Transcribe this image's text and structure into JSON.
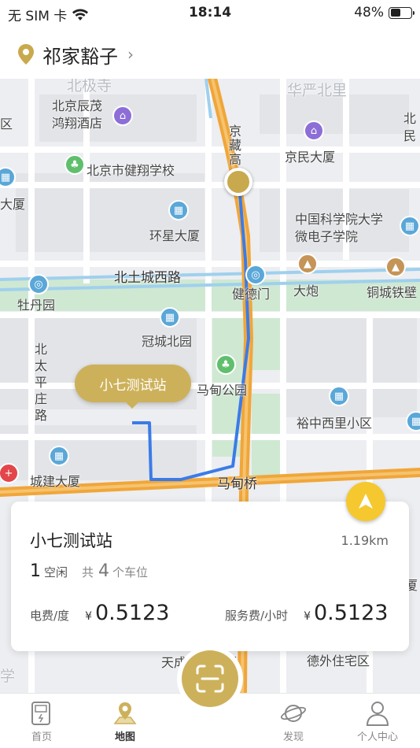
{
  "status_bar": {
    "carrier": "无 SIM 卡",
    "time": "18:14",
    "battery": "48%",
    "battery_level": 0.48
  },
  "location": {
    "name": "祁家豁子"
  },
  "map": {
    "labels": {
      "beiji_temple": "北极寺",
      "huayan_beili": "华严北里",
      "hotel": "北京辰茂\n鸿翔酒店",
      "jingzang": "京藏高",
      "jingmin": "京民大厦",
      "school": "北京市健翔学校",
      "dasha_left": "大厦",
      "huanxing": "环星大厦",
      "cas": "中国科学院大学\n微电子学院",
      "beitucheng": "北土城西路",
      "jiandemen": "健德门",
      "dapao": "大炮",
      "tongcheng": "铜城铁壁",
      "mudanyuan": "牡丹园",
      "guancheng": "冠城北园",
      "beitaiping": "北\n太\n平\n庄\n路",
      "madian_park": "马甸公园",
      "yuzhong": "裕中西里小区",
      "chengjian": "城建大厦",
      "madianqiao": "马甸桥",
      "tiancheng": "天成科技大厦",
      "dewai": "德外住宅区",
      "qu": "区",
      "min": "北\n民",
      "xue": "学",
      "sha": "厦"
    }
  },
  "station_marker": {
    "label": "小七测试站"
  },
  "station_card": {
    "name": "小七测试站",
    "distance": "1.19km",
    "free_count": "1",
    "free_label": "空闲",
    "total_prefix": "共",
    "total_count": "4",
    "total_suffix": "个车位",
    "electric_label": "电费/度",
    "electric_currency": "¥",
    "electric_price": "0.5123",
    "service_label": "服务费/小时",
    "service_currency": "¥",
    "service_price": "0.5123"
  },
  "tabbar": {
    "items": [
      {
        "label": "首页",
        "icon": "charger-icon"
      },
      {
        "label": "地图",
        "icon": "map-pin-icon"
      },
      {
        "label": "发现",
        "icon": "planet-icon"
      },
      {
        "label": "个人中心",
        "icon": "person-icon"
      }
    ],
    "active": "地图",
    "scan_icon": "scan-icon"
  },
  "colors": {
    "accent_gold": "#cdb15a",
    "route_blue": "#3b7be8",
    "highway_orange": "#f0a63a",
    "nav_yellow": "#f5c82f"
  }
}
